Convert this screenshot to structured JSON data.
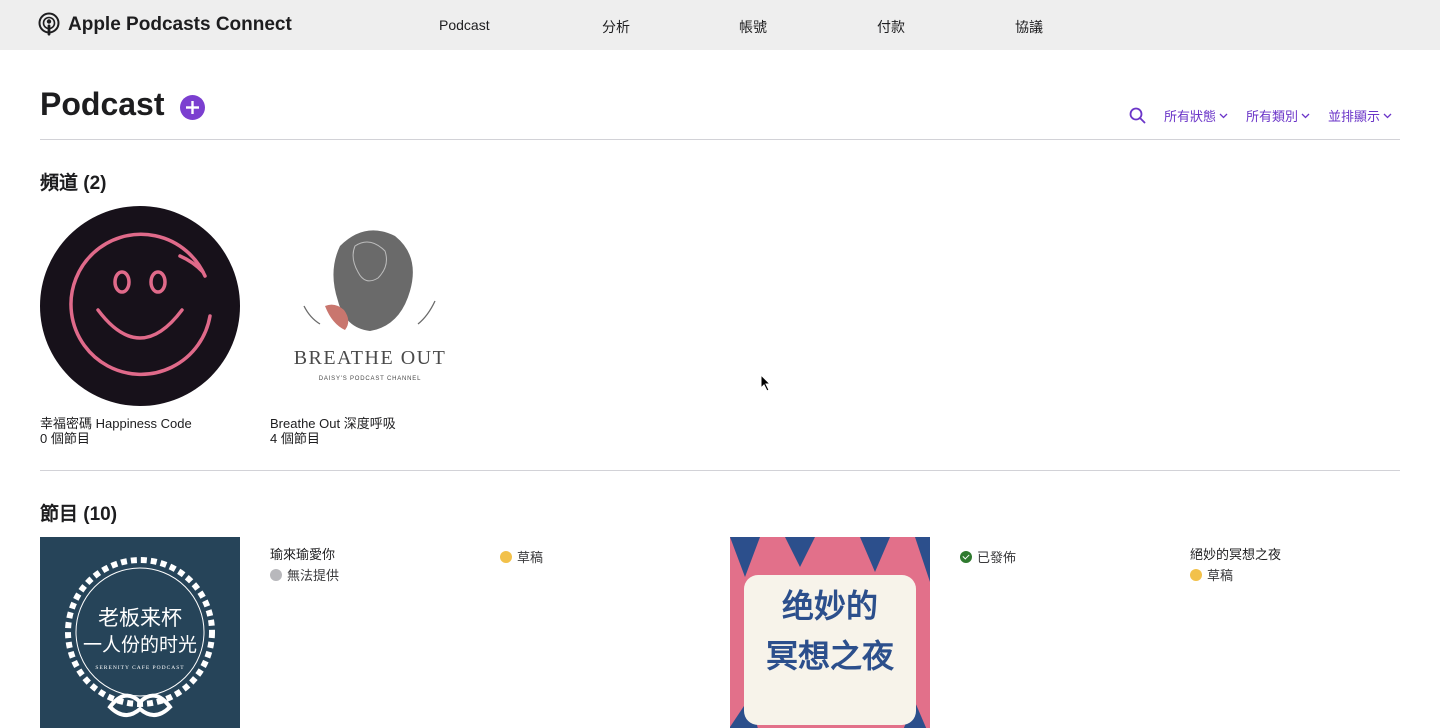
{
  "header": {
    "brand": "Apple Podcasts Connect",
    "nav": [
      "Podcast",
      "分析",
      "帳號",
      "付款",
      "協議"
    ]
  },
  "page": {
    "title": "Podcast",
    "filters": [
      "所有狀態",
      "所有類別",
      "並排顯示"
    ]
  },
  "channels": {
    "heading": "頻道 (2)",
    "items": [
      {
        "name": "幸福密碼 Happiness Code",
        "count": "0 個節目"
      },
      {
        "name": "Breathe Out 深度呼吸",
        "count": "4 個節目",
        "art_title": "BREATHE OUT",
        "art_subtitle": "DAISY'S PODCAST CHANNEL"
      }
    ]
  },
  "episodes": {
    "heading": "節目 (10)",
    "items": [
      {
        "title": "瑜來瑜愛你",
        "status": "無法提供",
        "art_line1": "老板来杯",
        "art_line2": "一人份的时光",
        "art_caption": "SERENITY CAFE PODCAST"
      },
      {
        "title": "",
        "status": "草稿"
      },
      {
        "title": "",
        "status": "已發佈",
        "art_line1": "绝妙的",
        "art_line2": "冥想之夜"
      },
      {
        "title": "絕妙的冥想之夜",
        "status": "草稿"
      }
    ]
  },
  "colors": {
    "accent": "#6b35c8",
    "add_button": "#7b3fd0",
    "draft": "#f2c14a",
    "published": "#2f7a2f",
    "unavailable": "#b8b8bc"
  }
}
